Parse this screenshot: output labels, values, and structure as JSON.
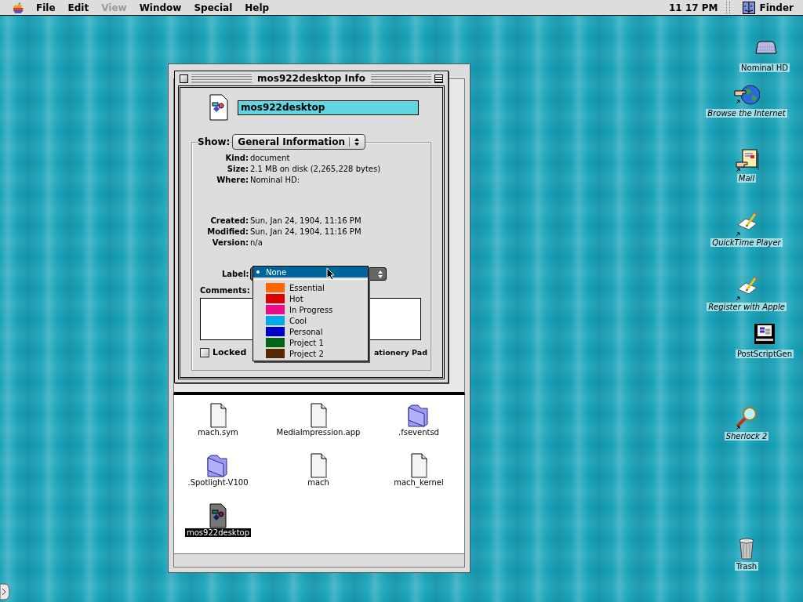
{
  "menubar": {
    "menus": [
      {
        "label": "File",
        "disabled": false
      },
      {
        "label": "Edit",
        "disabled": false
      },
      {
        "label": "View",
        "disabled": true
      },
      {
        "label": "Window",
        "disabled": false
      },
      {
        "label": "Special",
        "disabled": false
      },
      {
        "label": "Help",
        "disabled": false
      }
    ],
    "clock": "11 17 PM",
    "app": "Finder"
  },
  "finder_window": {
    "items": [
      {
        "name": "mach.sym",
        "kind": "document",
        "selected": false
      },
      {
        "name": "MediaImpression.app",
        "kind": "document",
        "selected": false
      },
      {
        "name": ".fseventsd",
        "kind": "folder",
        "selected": false
      },
      {
        "name": ".Spotlight-V100",
        "kind": "folder",
        "selected": false
      },
      {
        "name": "mach",
        "kind": "document",
        "selected": false
      },
      {
        "name": "mach_kernel",
        "kind": "document",
        "selected": false
      },
      {
        "name": "mos922desktop",
        "kind": "shapes-document",
        "selected": true
      }
    ]
  },
  "info_window": {
    "title": "mos922desktop Info",
    "name": "mos922desktop",
    "show_label": "Show:",
    "show_value": "General Information",
    "location_fields": [
      {
        "label": "Kind:",
        "value": "document"
      },
      {
        "label": "Size:",
        "value": "2.1 MB on disk (2,265,228 bytes)"
      },
      {
        "label": "Where:",
        "value": "Nominal HD:"
      }
    ],
    "date_fields": [
      {
        "label": "Created:",
        "value": "Sun, Jan 24, 1904, 11:16 PM"
      },
      {
        "label": "Modified:",
        "value": "Sun, Jan 24, 1904, 11:16 PM"
      },
      {
        "label": "Version:",
        "value": "n/a"
      }
    ],
    "label_field": {
      "label": "Label:",
      "menu": [
        {
          "name": "None",
          "selected": true
        },
        {
          "name": "Essential",
          "color": "#ff6600",
          "selected": false
        },
        {
          "name": "Hot",
          "color": "#dd0000",
          "selected": false
        },
        {
          "name": "In Progress",
          "color": "#f00a8a",
          "selected": false
        },
        {
          "name": "Cool",
          "color": "#00aae8",
          "selected": false
        },
        {
          "name": "Personal",
          "color": "#0000cc",
          "selected": false
        },
        {
          "name": "Project 1",
          "color": "#006616",
          "selected": false
        },
        {
          "name": "Project 2",
          "color": "#552800",
          "selected": false
        }
      ]
    },
    "comments_label": "Comments:",
    "locked": {
      "label": "Locked",
      "checked": false
    },
    "stationery_label": "ationery Pad"
  },
  "desktop_icons": [
    {
      "name": "Nominal HD",
      "alias": false
    },
    {
      "name": "Browse the Internet",
      "alias": true
    },
    {
      "name": "Mail",
      "alias": true
    },
    {
      "name": "QuickTime Player",
      "alias": true
    },
    {
      "name": "Register with Apple",
      "alias": true
    },
    {
      "name": "PostScriptGen",
      "alias": false
    },
    {
      "name": "Sherlock 2",
      "alias": true
    },
    {
      "name": "Trash",
      "alias": false
    }
  ]
}
